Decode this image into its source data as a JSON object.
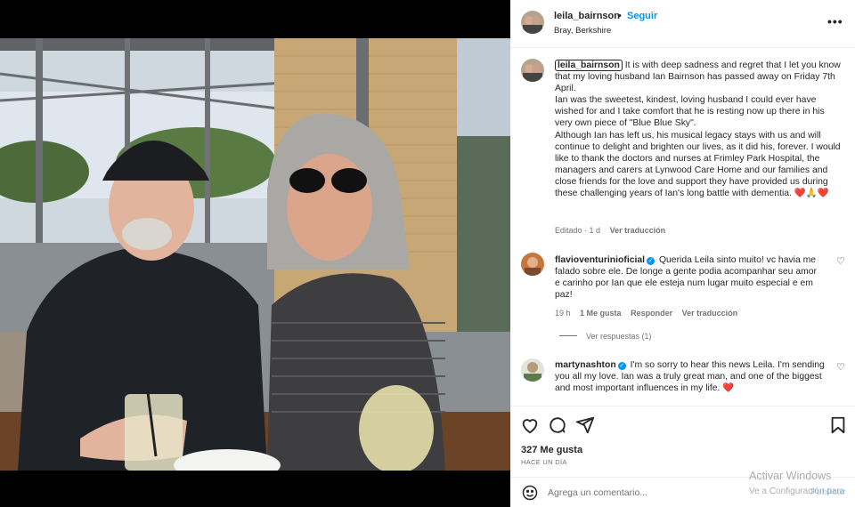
{
  "post": {
    "username": "leila_bairnson",
    "follow_label": "Seguir",
    "dot": "•",
    "location": "Bray, Berkshire",
    "more_label": "•••"
  },
  "caption": {
    "username": "leila_bairnson",
    "para1": "It is with deep sadness and regret that I let you know that my loving husband Ian Bairnson has passed away on Friday 7th April.",
    "para2": "Ian was the sweetest, kindest, loving husband I could ever have wished for and I take comfort that he is resting now up there in his very own piece of \"Blue Blue Sky\".",
    "para3": "Although Ian has left us, his musical legacy stays with us and will continue to delight and brighten our lives, as it did his, forever. I would like to thank the doctors and nurses at Frimley Park Hospital, the managers and carers at Lynwood Care Home and our families and close friends for the love and support they have provided us during these challenging years of Ian's long battle with dementia.",
    "emojis": "❤️🙏❤️",
    "edited": "Editado · 1 d",
    "see_translation": "Ver traducción"
  },
  "comments": [
    {
      "username": "flavioventurinioficial",
      "text": "Querida Leila sinto muito! vc havia me falado sobre ele. De longe a gente podia acompanhar seu amor e carinho por Ian que ele esteja num lugar muito especial e em paz!",
      "time": "19 h",
      "likes": "1 Me gusta",
      "reply": "Responder",
      "see_translation": "Ver traducción",
      "view_replies": "Ver respuestas (1)"
    },
    {
      "username": "martynashton",
      "text": "I'm so sorry to hear this news Leila. I'm sending you all my love. Ian was a truly great man, and one of the biggest and most important influences in my life.",
      "heart": "❤️"
    }
  ],
  "actions": {
    "likes": "327 Me gusta",
    "time_ago": "HACE UN DÍA"
  },
  "comment_box": {
    "placeholder": "Agrega un comentario...",
    "publish": "Publicar"
  },
  "watermark": {
    "line1": "Activar Windows",
    "line2": "Ve a Configuración para"
  },
  "colors": {
    "accent": "#0095f6",
    "heart": "#ed4956",
    "muted": "#737373"
  }
}
